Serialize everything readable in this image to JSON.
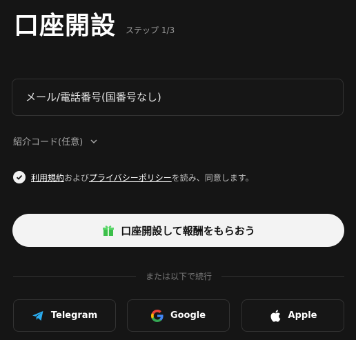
{
  "header": {
    "title": "口座開設",
    "step": "ステップ 1/3"
  },
  "form": {
    "input_placeholder": "メール/電話番号(国番号なし)",
    "input_value": ""
  },
  "referral": {
    "label": "紹介コード(任意)"
  },
  "terms": {
    "link1": "利用規約",
    "text1": "および",
    "link2": "プライバシーポリシー",
    "text2": "を読み、同意します。"
  },
  "cta": {
    "label": "口座開設して報酬をもらおう"
  },
  "divider": {
    "text": "または以下で続行"
  },
  "social": [
    {
      "label": "Telegram",
      "icon": "telegram-icon"
    },
    {
      "label": "Google",
      "icon": "google-icon"
    },
    {
      "label": "Apple",
      "icon": "apple-icon"
    }
  ],
  "colors": {
    "background": "#151515",
    "cta": "#f3f3f3",
    "border": "#333333"
  }
}
